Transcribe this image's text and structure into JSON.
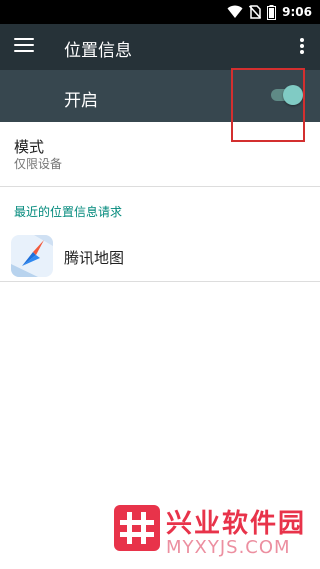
{
  "status_bar": {
    "time": "9:06",
    "icons": [
      "wifi-icon",
      "no-sim-icon",
      "battery-icon"
    ]
  },
  "app_bar": {
    "title": "位置信息",
    "menu_icon": "hamburger-menu-icon",
    "overflow_icon": "more-vert-icon"
  },
  "switch_bar": {
    "label": "开启",
    "toggle_on": true,
    "accent": "#80cbc4"
  },
  "mode": {
    "title": "模式",
    "value": "仅限设备"
  },
  "recent_requests": {
    "header": "最近的位置信息请求",
    "items": [
      {
        "name": "腾讯地图",
        "icon": "tencent-maps-icon"
      }
    ]
  },
  "watermark": {
    "name": "兴业软件园",
    "domain": "MYXYJS.COM"
  },
  "colors": {
    "status_bar": "#000000",
    "app_bar": "#263238",
    "switch_bar": "#37474f",
    "section_header": "#00897b",
    "highlight": "#d32f2f"
  }
}
